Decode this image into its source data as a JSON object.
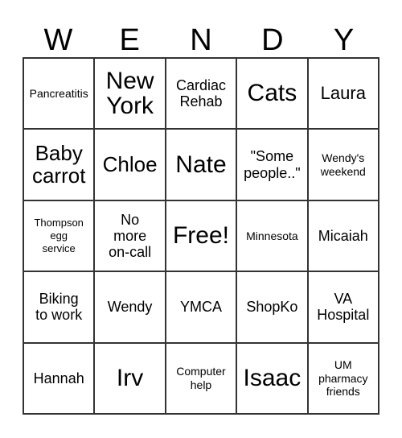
{
  "card": {
    "header_letters": [
      "W",
      "E",
      "N",
      "D",
      "Y"
    ],
    "columns": 5,
    "rows": 5,
    "border_color": "#333333",
    "background_color": "#ffffff",
    "text_color": "#000000",
    "cells": [
      {
        "text": "Pancreatitis",
        "size": "sz-s",
        "row": 1,
        "col": 1,
        "free": false
      },
      {
        "text": "New\nYork",
        "size": "sz-xxl",
        "row": 1,
        "col": 2,
        "free": false
      },
      {
        "text": "Cardiac\nRehab",
        "size": "sz-m",
        "row": 1,
        "col": 3,
        "free": false
      },
      {
        "text": "Cats",
        "size": "sz-xxl",
        "row": 1,
        "col": 4,
        "free": false
      },
      {
        "text": "Laura",
        "size": "sz-l",
        "row": 1,
        "col": 5,
        "free": false
      },
      {
        "text": "Baby\ncarrot",
        "size": "sz-xl",
        "row": 2,
        "col": 1,
        "free": false
      },
      {
        "text": "Chloe",
        "size": "sz-xl",
        "row": 2,
        "col": 2,
        "free": false
      },
      {
        "text": "Nate",
        "size": "sz-xxl",
        "row": 2,
        "col": 3,
        "free": false
      },
      {
        "text": "\"Some\npeople..\"",
        "size": "sz-m",
        "row": 2,
        "col": 4,
        "free": false
      },
      {
        "text": "Wendy's\nweekend",
        "size": "sz-s",
        "row": 2,
        "col": 5,
        "free": false
      },
      {
        "text": "Thompson\negg\nservice",
        "size": "sz-xs",
        "row": 3,
        "col": 1,
        "free": false
      },
      {
        "text": "No\nmore\non-call",
        "size": "sz-m",
        "row": 3,
        "col": 2,
        "free": false
      },
      {
        "text": "Free!",
        "size": "sz-xxl",
        "row": 3,
        "col": 3,
        "free": true
      },
      {
        "text": "Minnesota",
        "size": "sz-s",
        "row": 3,
        "col": 4,
        "free": false
      },
      {
        "text": "Micaiah",
        "size": "sz-m",
        "row": 3,
        "col": 5,
        "free": false
      },
      {
        "text": "Biking\nto work",
        "size": "sz-m",
        "row": 4,
        "col": 1,
        "free": false
      },
      {
        "text": "Wendy",
        "size": "sz-m",
        "row": 4,
        "col": 2,
        "free": false
      },
      {
        "text": "YMCA",
        "size": "sz-m",
        "row": 4,
        "col": 3,
        "free": false
      },
      {
        "text": "ShopKo",
        "size": "sz-m",
        "row": 4,
        "col": 4,
        "free": false
      },
      {
        "text": "VA\nHospital",
        "size": "sz-m",
        "row": 4,
        "col": 5,
        "free": false
      },
      {
        "text": "Hannah",
        "size": "sz-m",
        "row": 5,
        "col": 1,
        "free": false
      },
      {
        "text": "Irv",
        "size": "sz-xxl",
        "row": 5,
        "col": 2,
        "free": false
      },
      {
        "text": "Computer\nhelp",
        "size": "sz-s",
        "row": 5,
        "col": 3,
        "free": false
      },
      {
        "text": "Isaac",
        "size": "sz-xxl",
        "row": 5,
        "col": 4,
        "free": false
      },
      {
        "text": "UM\npharmacy\nfriends",
        "size": "sz-s",
        "row": 5,
        "col": 5,
        "free": false
      }
    ]
  }
}
